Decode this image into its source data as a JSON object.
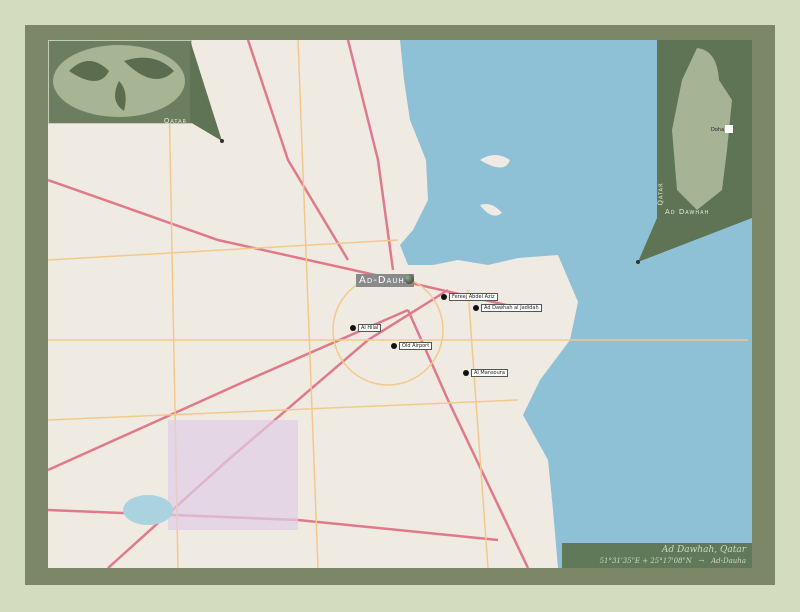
{
  "map": {
    "city_label": "Ad-Dauha",
    "places": [
      "Fereej Abdel Aziz",
      "Al Hilal",
      "Ad Dawhah al Jadidah",
      "Old Airport",
      "Al Mansoura"
    ],
    "colors": {
      "sea": "#8ec1d6",
      "land": "#efeae2",
      "frame": "#7c8768",
      "background": "#d3dcbf"
    }
  },
  "inset_world": {
    "label": "Qatar"
  },
  "inset_country": {
    "country_label": "Qatar",
    "region_label": "Ad Dawhah",
    "city_label": "Doha"
  },
  "caption": {
    "title": "Ad Dawhah, Qatar",
    "coords": "51°31'35\"E + 25°17'08\"N",
    "arrow": "→",
    "place": "Ad-Dauha"
  }
}
